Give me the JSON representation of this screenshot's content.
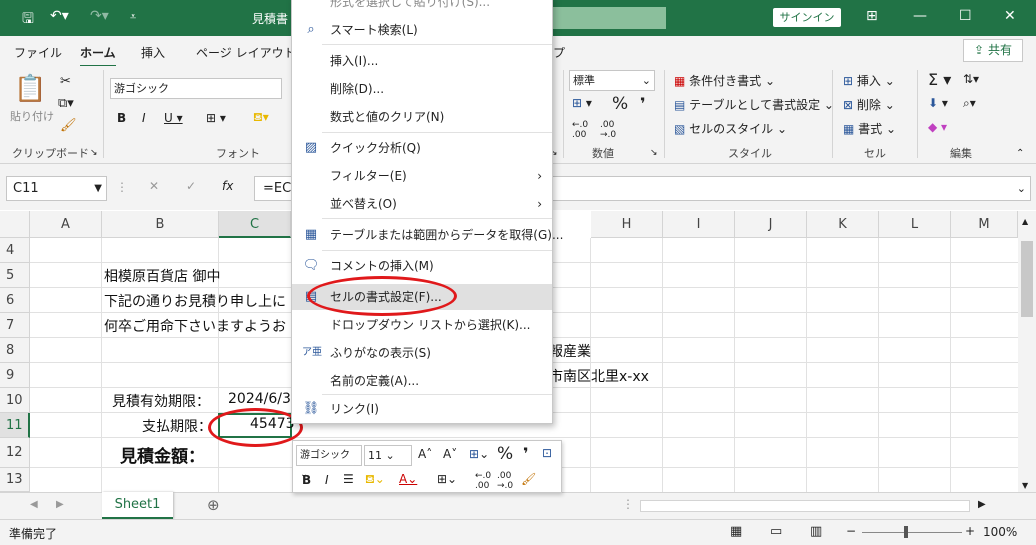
{
  "titlebar": {
    "title": "見積書 - E",
    "signin": "サインイン"
  },
  "tabs": [
    "ファイル",
    "ホーム",
    "挿入",
    "ページ レイアウト",
    "プ"
  ],
  "share_label": "共有",
  "ribbon": {
    "paste": "貼り付け",
    "clipboard": "クリップボード",
    "font_name": "游ゴシック",
    "font_group": "フォント",
    "number_format": "標準",
    "number_group": "数値",
    "cond_format": "条件付き書式",
    "format_table": "テーブルとして書式設定",
    "cell_style": "セルのスタイル",
    "style_group": "スタイル",
    "insert": "挿入",
    "delete": "削除",
    "format": "書式",
    "cells_group": "セル",
    "edit_group": "編集"
  },
  "formula": {
    "namebox": "C11",
    "fx": "=EC",
    "fx_label": "fx"
  },
  "columns": [
    "A",
    "B",
    "C",
    "H",
    "I",
    "J",
    "K",
    "L",
    "M"
  ],
  "rows": [
    "4",
    "5",
    "6",
    "7",
    "8",
    "9",
    "10",
    "11",
    "12",
    "13"
  ],
  "cells": {
    "b5": "相模原百貨店 御中",
    "b6": "下記の通りお見積り申し上に",
    "b7": "何卒ご用命下さいますようお",
    "h8": "報産業",
    "h9": "市南区北里x-xx",
    "b10": "見積有効期限：",
    "c10": "2024/6/3",
    "b11": "支払期限：",
    "c11": "45473",
    "b12": "見積金額："
  },
  "context_menu": {
    "top_partial": "形式を選択して貼り付け(S)...",
    "items": [
      {
        "label": "スマート検索(L)",
        "icon": "search-icon"
      },
      {
        "label": "挿入(I)..."
      },
      {
        "label": "削除(D)..."
      },
      {
        "label": "数式と値のクリア(N)"
      },
      {
        "label": "クイック分析(Q)",
        "icon": "quick-analysis-icon"
      },
      {
        "label": "フィルター(E)",
        "submenu": true
      },
      {
        "label": "並べ替え(O)",
        "submenu": true
      },
      {
        "label": "テーブルまたは範囲からデータを取得(G)...",
        "icon": "table-icon"
      },
      {
        "label": "コメントの挿入(M)",
        "icon": "comment-icon"
      },
      {
        "label": "セルの書式設定(F)...",
        "icon": "format-cells-icon"
      },
      {
        "label": "ドロップダウン リストから選択(K)..."
      },
      {
        "label": "ふりがなの表示(S)",
        "icon": "furigana-icon"
      },
      {
        "label": "名前の定義(A)..."
      },
      {
        "label": "リンク(I)",
        "icon": "link-icon"
      }
    ]
  },
  "mini_toolbar": {
    "font": "游ゴシック",
    "size": "11",
    "percent": "%"
  },
  "sheet_tab": "Sheet1",
  "status": {
    "ready": "準備完了",
    "zoom": "100%"
  },
  "colors": {
    "accent": "#217346",
    "highlight_ring": "#e0191b"
  }
}
